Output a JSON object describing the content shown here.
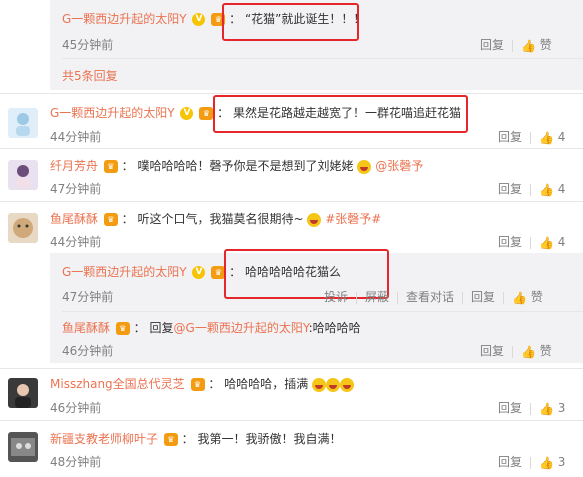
{
  "sub_reply_1": {
    "name": "G一颗西边升起的太阳Y",
    "badge": "V",
    "sep": "：",
    "text": "“花猫”就此诞生！！！",
    "time": "45分钟前",
    "reply": "回复",
    "like": "赞"
  },
  "expand_link": "共5条回复",
  "comments": [
    {
      "name": "G一颗西边升起的太阳Y",
      "badge": "V",
      "sep": "：",
      "text": "果然是花路越走越宽了！一群花喵追赶花猫",
      "time": "44分钟前",
      "reply": "回复",
      "likes": "4"
    },
    {
      "name": "纤月芳舟",
      "sep": "：",
      "text": "噗哈哈哈哈！磬予你是不是想到了刘姥姥",
      "mention": "@张磬予",
      "time": "47分钟前",
      "reply": "回复",
      "likes": "4"
    },
    {
      "name": "鱼尾酥酥",
      "sep": "：",
      "text": "听这个口气，我猫莫名很期待~",
      "tag": "#张磬予#",
      "time": "44分钟前",
      "reply": "回复",
      "likes": "4"
    }
  ],
  "sub_reply_2": {
    "name": "G一颗西边升起的太阳Y",
    "badge": "V",
    "sep": "：",
    "text": "哈哈哈哈哈花猫么",
    "time": "47分钟前",
    "report": "投诉",
    "block": "屏蔽",
    "view_dialog": "查看对话",
    "reply": "回复",
    "like": "赞"
  },
  "sub_reply_3": {
    "name": "鱼尾酥酥",
    "sep": "：",
    "text_prefix": "回复",
    "mention": "@G一颗西边升起的太阳Y",
    "text_suffix": ":哈哈哈哈",
    "time": "46分钟前",
    "reply": "回复",
    "like": "赞"
  },
  "comments_b": [
    {
      "name": "Misszhang全国总代灵芝",
      "sep": "：",
      "text": "哈哈哈哈，插满",
      "time": "46分钟前",
      "reply": "回复",
      "likes": "3"
    },
    {
      "name": "新疆支教老师柳叶子",
      "sep": "：",
      "text": "我第一！我骄傲！我自满！",
      "time": "48分钟前",
      "reply": "回复",
      "likes": "3"
    }
  ],
  "colors": {
    "accent": "#eb7350",
    "highlight": "#e5262b",
    "gold": "#f6c400"
  }
}
